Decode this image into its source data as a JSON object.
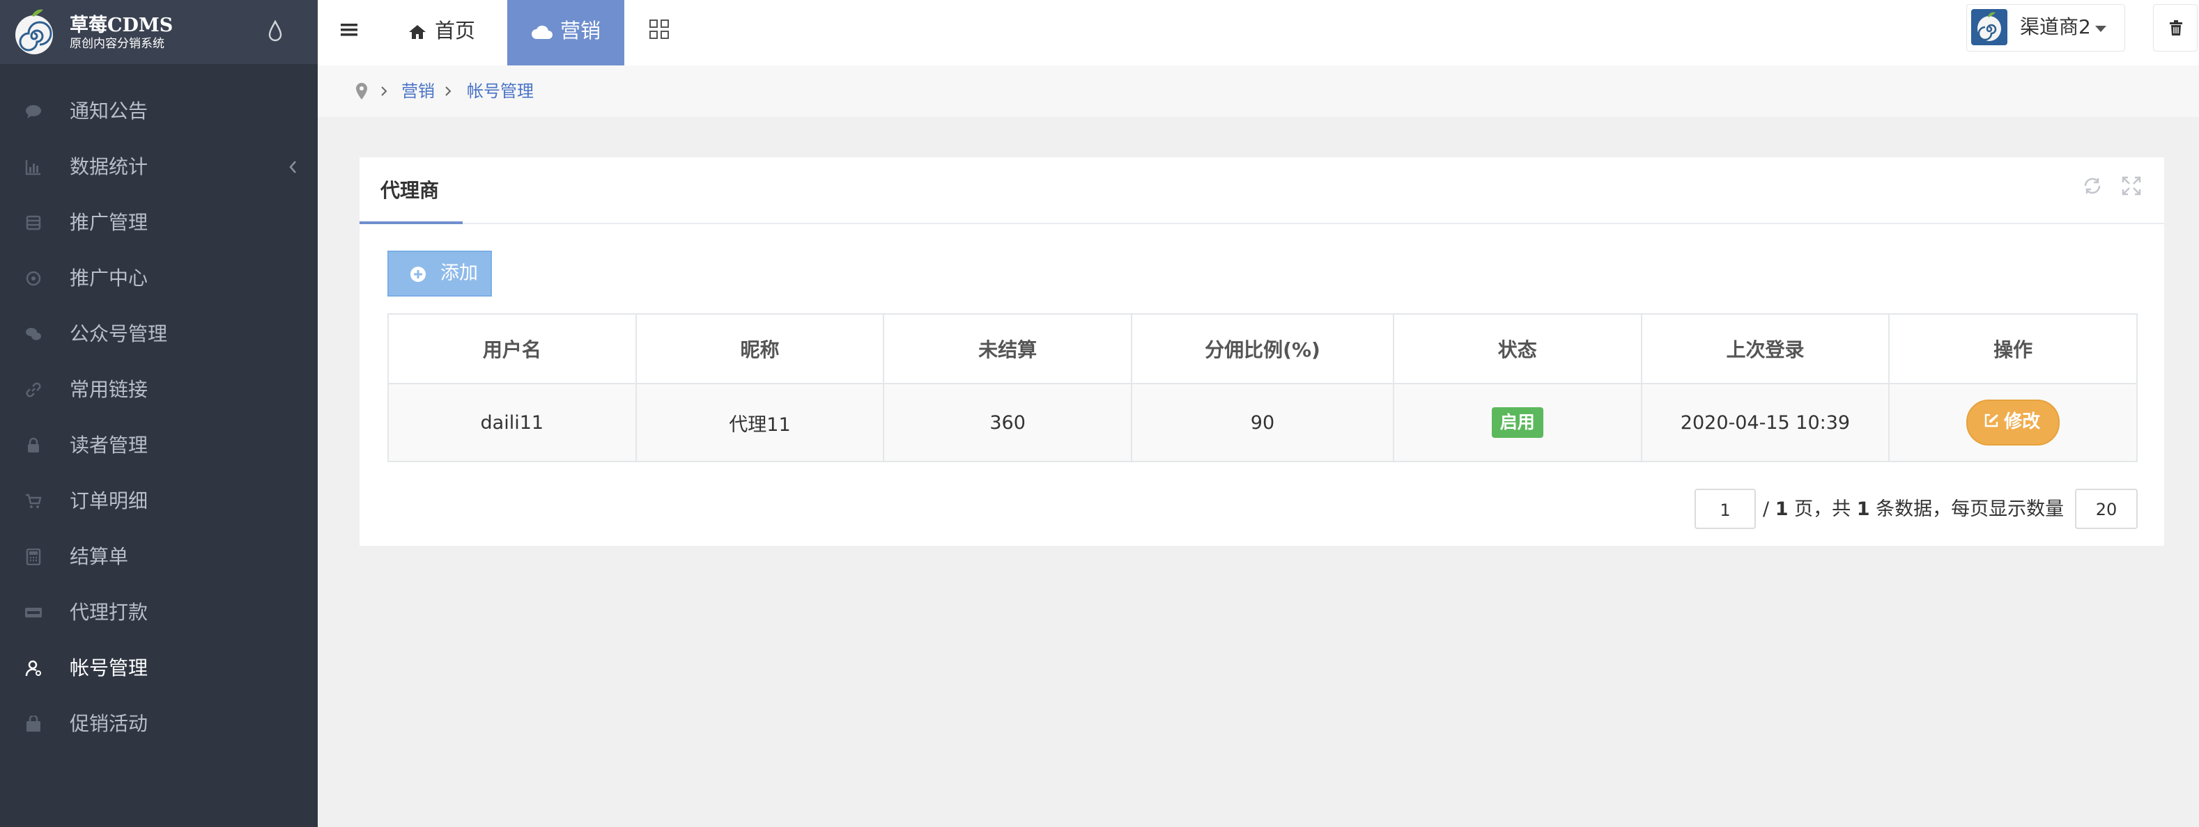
{
  "app": {
    "logo_title": "草莓CDMS",
    "logo_subtitle": "原创内容分销系统"
  },
  "sidebar": {
    "items": [
      {
        "label": "通知公告",
        "icon": "chat-bubble-icon"
      },
      {
        "label": "数据统计",
        "icon": "bar-chart-icon",
        "has_arrow": true
      },
      {
        "label": "推广管理",
        "icon": "coins-icon"
      },
      {
        "label": "推广中心",
        "icon": "badge-icon"
      },
      {
        "label": "公众号管理",
        "icon": "wechat-icon"
      },
      {
        "label": "常用链接",
        "icon": "link-icon"
      },
      {
        "label": "读者管理",
        "icon": "lock-icon"
      },
      {
        "label": "订单明细",
        "icon": "cart-icon"
      },
      {
        "label": "结算单",
        "icon": "calculator-icon"
      },
      {
        "label": "代理打款",
        "icon": "visa-card-icon"
      },
      {
        "label": "帐号管理",
        "icon": "user-icon",
        "active": true
      },
      {
        "label": "促销活动",
        "icon": "shopping-bag-icon"
      }
    ]
  },
  "topbar": {
    "home_label": "首页",
    "marketing_label": "营销",
    "user_name": "渠道商2"
  },
  "breadcrumb": {
    "level1": "营销",
    "level2": "帐号管理"
  },
  "panel": {
    "title": "代理商",
    "add_label": "添加"
  },
  "table": {
    "columns": [
      "用户名",
      "昵称",
      "未结算",
      "分佣比例(%)",
      "状态",
      "上次登录",
      "操作"
    ],
    "rows": [
      {
        "username": "daili11",
        "nickname": "代理11",
        "unsettled": "360",
        "commission": "90",
        "status": "启用",
        "last_login": "2020-04-15 10:39",
        "action": "修改"
      }
    ]
  },
  "pagination": {
    "current_page": "1",
    "text_total_pages_prefix": "/",
    "total_pages": "1",
    "text_pages_suffix": "页，共",
    "total_records": "1",
    "text_records_suffix": "条数据，每页显示数量",
    "page_size": "20"
  },
  "colors": {
    "sidebar_bg": "#2f3541",
    "accent": "#6f8fce",
    "status_green": "#5cb85c",
    "edit_orange": "#f0ad4e",
    "add_blue": "#8fbbea"
  }
}
